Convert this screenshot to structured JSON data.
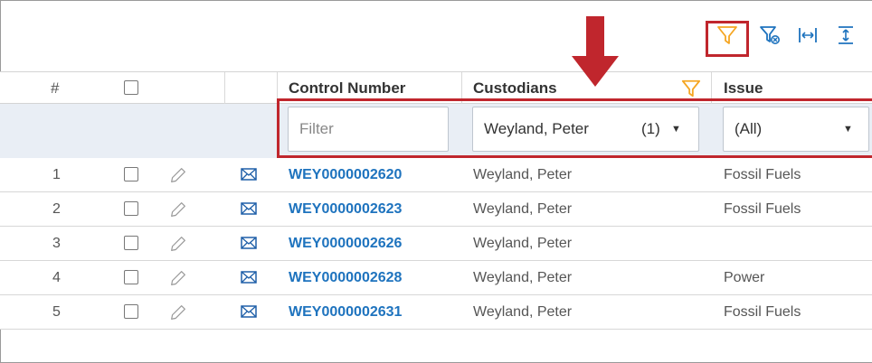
{
  "toolbar": {
    "icons": [
      "filter-icon",
      "clear-filter-icon",
      "fit-columns-icon",
      "fit-rows-icon"
    ],
    "colors": {
      "icon_blue": "#1e73be",
      "filter_orange": "#f5a623",
      "highlight_red": "#c0262d"
    }
  },
  "header": {
    "hash": "#",
    "control_number": "Control Number",
    "custodians": "Custodians",
    "issue": "Issue"
  },
  "filters": {
    "control_number_placeholder": "Filter",
    "custodians_value": "Weyland, Peter",
    "custodians_count": "(1)",
    "issue_value": "(All)"
  },
  "rows": [
    {
      "num": "1",
      "control": "WEY0000002620",
      "custodian": "Weyland, Peter",
      "issue": "Fossil Fuels"
    },
    {
      "num": "2",
      "control": "WEY0000002623",
      "custodian": "Weyland, Peter",
      "issue": "Fossil Fuels"
    },
    {
      "num": "3",
      "control": "WEY0000002626",
      "custodian": "Weyland, Peter",
      "issue": ""
    },
    {
      "num": "4",
      "control": "WEY0000002628",
      "custodian": "Weyland, Peter",
      "issue": "Power"
    },
    {
      "num": "5",
      "control": "WEY0000002631",
      "custodian": "Weyland, Peter",
      "issue": "Fossil Fuels"
    }
  ]
}
